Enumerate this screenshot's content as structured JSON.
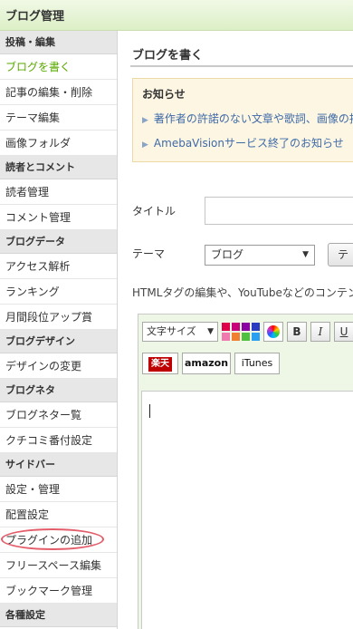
{
  "app": {
    "title": "ブログ管理"
  },
  "sidebar": {
    "sections": [
      {
        "header": "投稿・編集",
        "items": [
          "ブログを書く",
          "記事の編集・削除",
          "テーマ編集",
          "画像フォルダ"
        ]
      },
      {
        "header": "読者とコメント",
        "items": [
          "読者管理",
          "コメント管理"
        ]
      },
      {
        "header": "ブログデータ",
        "items": [
          "アクセス解析",
          "ランキング",
          "月間段位アップ賞"
        ]
      },
      {
        "header": "ブログデザイン",
        "items": [
          "デザインの変更"
        ]
      },
      {
        "header": "ブログネタ",
        "items": [
          "ブログネター覧",
          "クチコミ番付設定"
        ]
      },
      {
        "header": "サイドバー",
        "items": [
          "設定・管理",
          "配置設定",
          "プラグインの追加",
          "フリースペース編集",
          "ブックマーク管理"
        ]
      },
      {
        "header": "各種設定",
        "items": []
      }
    ],
    "active_item": "ブログを書く",
    "highlighted_item": "プラグインの追加"
  },
  "main": {
    "page_title": "ブログを書く",
    "notice": {
      "title": "お知らせ",
      "links": [
        "著作者の許諾のない文章や歌詞、画像の掲",
        "AmebaVisionサービス終了のお知らせ"
      ]
    },
    "form": {
      "title_label": "タイトル",
      "title_value": "",
      "theme_label": "テーマ",
      "theme_selected": "ブログ",
      "theme_button_label": "テ",
      "html_note": "HTMLタグの編集や、YouTubeなどのコンテン"
    },
    "editor": {
      "font_size_label": "文字サイズ",
      "bold_label": "B",
      "italic_label": "I",
      "underline_label": "U",
      "rakuten_label": "楽天",
      "amazon_label": "amazon",
      "itunes_label": "iTunes",
      "body": ""
    }
  },
  "colors": {
    "header_green": "#dcefc6",
    "active_green": "#5aa800",
    "link_blue": "#3e6aa8",
    "notice_bg": "#fdf6e3",
    "highlight_circle": "#e35d6a",
    "swatches": [
      "#e0004a",
      "#c8007a",
      "#8a00a0",
      "#2a3cc0",
      "#f07ab0",
      "#f08030",
      "#50c040",
      "#2aa0f0"
    ]
  }
}
